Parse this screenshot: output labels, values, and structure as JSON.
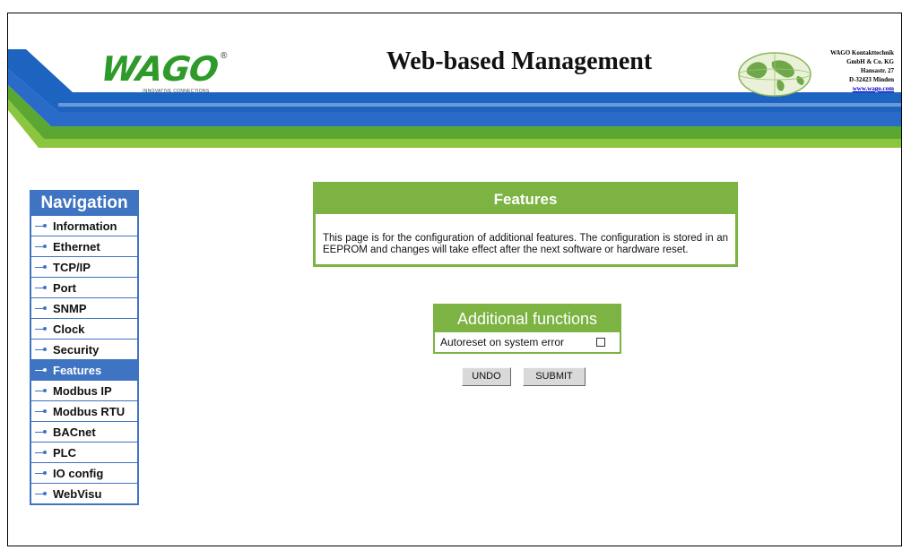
{
  "header": {
    "logo_text": "WAGO",
    "logo_registered": "®",
    "logo_tagline": "INNOVATIVE CONNECTIONS",
    "title": "Web-based Management",
    "company_lines": [
      "WAGO Kontakttechnik",
      "GmbH & Co. KG",
      "Hansastr. 27",
      "D-32423 Minden"
    ],
    "company_url": "www.wago.com"
  },
  "navigation": {
    "title": "Navigation",
    "items": [
      {
        "label": "Information"
      },
      {
        "label": "Ethernet"
      },
      {
        "label": "TCP/IP"
      },
      {
        "label": "Port"
      },
      {
        "label": "SNMP"
      },
      {
        "label": "Clock"
      },
      {
        "label": "Security"
      },
      {
        "label": "Features"
      },
      {
        "label": "Modbus IP"
      },
      {
        "label": "Modbus RTU"
      },
      {
        "label": "BACnet"
      },
      {
        "label": "PLC"
      },
      {
        "label": "IO config"
      },
      {
        "label": "WebVisu"
      }
    ],
    "active": "Features"
  },
  "features": {
    "title": "Features",
    "description": "This page is for the configuration of additional features. The configuration is stored in an EEPROM and changes will take effect after the next software or hardware reset."
  },
  "additional_functions": {
    "title": "Additional functions",
    "autoreset_label": "Autoreset on system error",
    "autoreset_checked": false
  },
  "buttons": {
    "undo": "UNDO",
    "submit": "SUBMIT"
  },
  "colors": {
    "nav_blue": "#3e74c2",
    "accent_green": "#7cb342",
    "stripe_blue": "#1d63c0",
    "stripe_green": "#5aa832"
  }
}
